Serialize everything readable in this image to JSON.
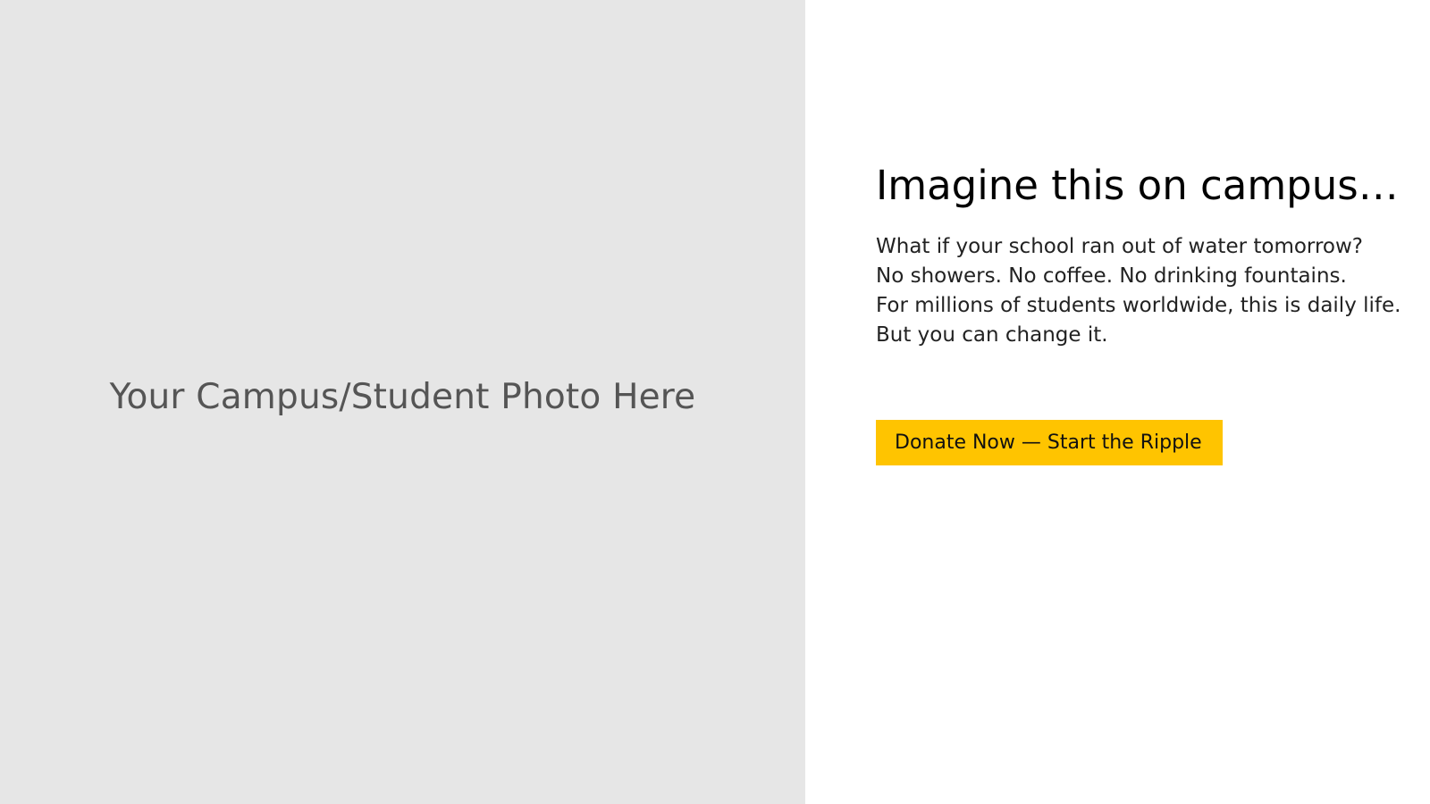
{
  "photo_panel": {
    "placeholder_text": "Your Campus/Student Photo Here"
  },
  "content": {
    "headline": "Imagine this on campus…",
    "body_lines": [
      "What if your school ran out of water tomorrow?",
      "No showers. No coffee. No drinking fountains.",
      "For millions of students worldwide, this is daily life.",
      "But you can change it."
    ],
    "cta_label": "Donate Now — Start the Ripple"
  },
  "colors": {
    "photo_background": "#e6e6e6",
    "placeholder_text": "#555555",
    "cta_background": "#ffc400"
  }
}
